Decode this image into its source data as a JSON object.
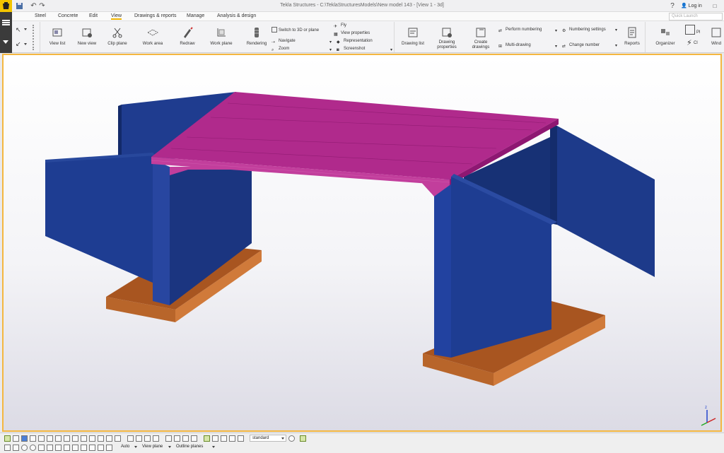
{
  "window": {
    "title": "Tekla Structures - C:\\TeklaStructuresModels\\New model 143 - [View 1 - 3d]",
    "help": "?",
    "login": "Log in",
    "quick_launch_placeholder": "Quick Launch"
  },
  "menu": {
    "items": [
      "Steel",
      "Concrete",
      "Edit",
      "View",
      "Drawings & reports",
      "Manage",
      "Analysis & design"
    ],
    "active": "View"
  },
  "ribbon": {
    "view_list": "View list",
    "new_view": "New view",
    "clip_plane": "Clip plane",
    "work_area": "Work area",
    "redraw": "Redraw",
    "work_plane": "Work plane",
    "rendering": "Rendering",
    "switch_3d": "Switch to 3D or plane",
    "navigate": "Navigate",
    "zoom": "Zoom",
    "fly": "Fly",
    "view_properties": "View properties",
    "representation": "Representation",
    "screenshot": "Screenshot",
    "drawing_list": "Drawing list",
    "drawing_properties_1": "Drawing",
    "drawing_properties_2": "properties",
    "create_drawings_1": "Create",
    "create_drawings_2": "drawings",
    "perform_numbering": "Perform numbering",
    "multi_drawing": "Multi-drawing",
    "numbering_settings": "Numbering settings",
    "change_number": "Change number",
    "reports": "Reports",
    "organizer": "Organizer",
    "cut_pi": "Pl",
    "cut_cl": "Cl",
    "cut_windows": "Wind"
  },
  "statusbar": {
    "select_filter": "standard",
    "snap_mode": "Auto",
    "plane_mode": "View plane",
    "outline": "Outline planes"
  },
  "colors": {
    "accent": "#f4b740",
    "deck": "#a1157c",
    "wall": "#1b3a8c",
    "footing": "#b8632a"
  }
}
